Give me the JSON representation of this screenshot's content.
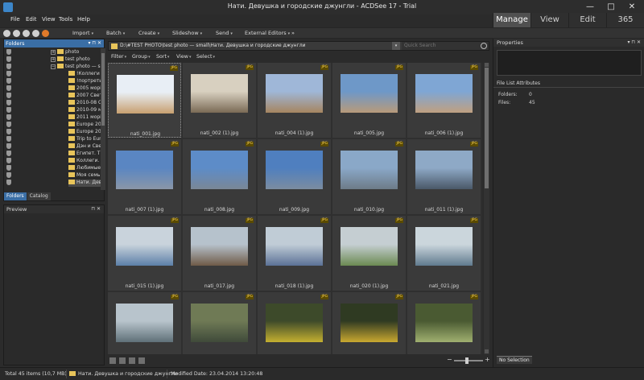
{
  "window": {
    "title": "Нати. Девушка и городские джунгли - ACDSee 17 - Trial",
    "minimize_glyph": "—",
    "maximize_glyph": "□",
    "close_glyph": "✕"
  },
  "menu": [
    "File",
    "Edit",
    "View",
    "Tools",
    "Help"
  ],
  "mode_tabs": [
    "Manage",
    "View",
    "Edit",
    "365"
  ],
  "toolbar": {
    "items": [
      "Import",
      "Batch",
      "Create",
      "Slideshow",
      "Send",
      "External Editors"
    ],
    "more_glyph": "»"
  },
  "folders_panel": {
    "title": "Folders",
    "tree": [
      {
        "label": "photo",
        "expander": "+"
      },
      {
        "label": "test photo",
        "expander": "+"
      },
      {
        "label": "test photo — sm",
        "expander": "−"
      },
      {
        "label": "!Коллеги А"
      },
      {
        "label": "!портреты"
      },
      {
        "label": "2005 морі"
      },
      {
        "label": "2007 Свет"
      },
      {
        "label": "2010-08 С"
      },
      {
        "label": "2010-09 м"
      },
      {
        "label": "2011 морі"
      },
      {
        "label": "Europe 20"
      },
      {
        "label": "Europe 20"
      },
      {
        "label": "Trip to Eur"
      },
      {
        "label": "Дэн и Све"
      },
      {
        "label": "Египет. Т"
      },
      {
        "label": "Коллеги. А"
      },
      {
        "label": "Любимые"
      },
      {
        "label": "Моя семь"
      },
      {
        "label": "Нати. Дев"
      }
    ],
    "tabs": [
      "Folders",
      "Catalog"
    ]
  },
  "preview_panel": {
    "title": "Preview"
  },
  "pathbar": {
    "path": "D:\\#TEST PHOTO\\test photo — small\\Нати. Девушка и городские джунгли",
    "search_placeholder": "Quick Search",
    "dropdown_glyph": "▾"
  },
  "filterbar": [
    "Filter",
    "Group",
    "Sort",
    "View",
    "Select"
  ],
  "files": [
    {
      "name": "nati_001.jpg",
      "badge": "JPG",
      "colors": [
        "#e8eef5",
        "#c8a070"
      ]
    },
    {
      "name": "nati_002 (1).jpg",
      "badge": "JPG",
      "colors": [
        "#d8d0c0",
        "#7a6a55"
      ]
    },
    {
      "name": "nati_004 (1).jpg",
      "badge": "JPG",
      "colors": [
        "#9fb7d8",
        "#a68560"
      ]
    },
    {
      "name": "nati_005.jpg",
      "badge": "JPG",
      "colors": [
        "#6e98c8",
        "#b89a7a"
      ]
    },
    {
      "name": "nati_006 (1).jpg",
      "badge": "JPG",
      "colors": [
        "#7fa6d4",
        "#c0a080"
      ]
    },
    {
      "name": "nati_007 (1).jpg",
      "badge": "JPG",
      "colors": [
        "#5a86c2",
        "#8a96a8"
      ]
    },
    {
      "name": "nati_008.jpg",
      "badge": "JPG",
      "colors": [
        "#5d8cc8",
        "#7a8796"
      ]
    },
    {
      "name": "nati_009.jpg",
      "badge": "JPG",
      "colors": [
        "#4f7fbf",
        "#7b8ca0"
      ]
    },
    {
      "name": "nati_010.jpg",
      "badge": "JPG",
      "colors": [
        "#8aa8c8",
        "#6d7b88"
      ]
    },
    {
      "name": "nati_011 (1).jpg",
      "badge": "JPG",
      "colors": [
        "#8ea9c6",
        "#4a5868"
      ]
    },
    {
      "name": "nati_015 (1).jpg",
      "badge": "JPG",
      "colors": [
        "#c9d3dc",
        "#5c7fa8"
      ]
    },
    {
      "name": "nati_017.jpg",
      "badge": "JPG",
      "colors": [
        "#b6c2cc",
        "#6f5a48"
      ]
    },
    {
      "name": "nati_018 (1).jpg",
      "badge": "JPG",
      "colors": [
        "#c0ccd6",
        "#5b7196"
      ]
    },
    {
      "name": "nati_020 (1).jpg",
      "badge": "JPG",
      "colors": [
        "#c5ced2",
        "#6b8a52"
      ]
    },
    {
      "name": "nati_021.jpg",
      "badge": "JPG",
      "colors": [
        "#cbd6dc",
        "#607a8e"
      ]
    },
    {
      "name": "",
      "badge": "JPG",
      "colors": [
        "#b8c4cc",
        "#5f7078"
      ]
    },
    {
      "name": "",
      "badge": "JPG",
      "colors": [
        "#6f7a55",
        "#3f4a3a"
      ]
    },
    {
      "name": "",
      "badge": "JPG",
      "colors": [
        "#3d4a2a",
        "#c4b030"
      ]
    },
    {
      "name": "",
      "badge": "JPG",
      "colors": [
        "#2f3a22",
        "#c9a830"
      ]
    },
    {
      "name": "",
      "badge": "JPG",
      "colors": [
        "#4a5a32",
        "#a0b070"
      ]
    }
  ],
  "zoom": {
    "minus": "−",
    "plus": "+"
  },
  "properties": {
    "title": "Properties",
    "section": "File List Attributes",
    "rows": [
      {
        "label": "Folders:",
        "value": "0"
      },
      {
        "label": "Files:",
        "value": "45"
      }
    ],
    "tab": "No Selection"
  },
  "status": {
    "total": "Total 45 items  (10,7 MB)",
    "folder": "Нати. Девушка и городские джунгли",
    "modified": "Modified Date: 23.04.2014 13:20:48"
  }
}
